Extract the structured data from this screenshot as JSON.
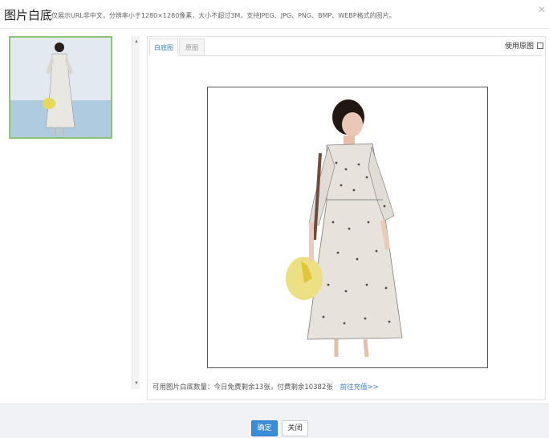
{
  "header": {
    "title": "图片白底",
    "subtitle": "仅展示URL非中文，分辨率小于1280×1280像素，大小不超过3M，支持JPEG、JPG、PNG、BMP、WEBP格式的图片。",
    "close_icon": "close-icon"
  },
  "tabs": [
    {
      "label": "白底图",
      "active": true
    },
    {
      "label": "原图",
      "active": false
    }
  ],
  "options": {
    "use_original_label": "使用原图"
  },
  "quota": {
    "text": "可用图片白底数量：今日免费剩余13张，付费剩余10382张",
    "link": "前往充值>>"
  },
  "footer": {
    "confirm_label": "确定",
    "close_label": "关闭"
  },
  "colors": {
    "accent": "#3c8bd9",
    "thumb_border": "#8cc47a",
    "footer_bg": "#f0f2f5"
  }
}
